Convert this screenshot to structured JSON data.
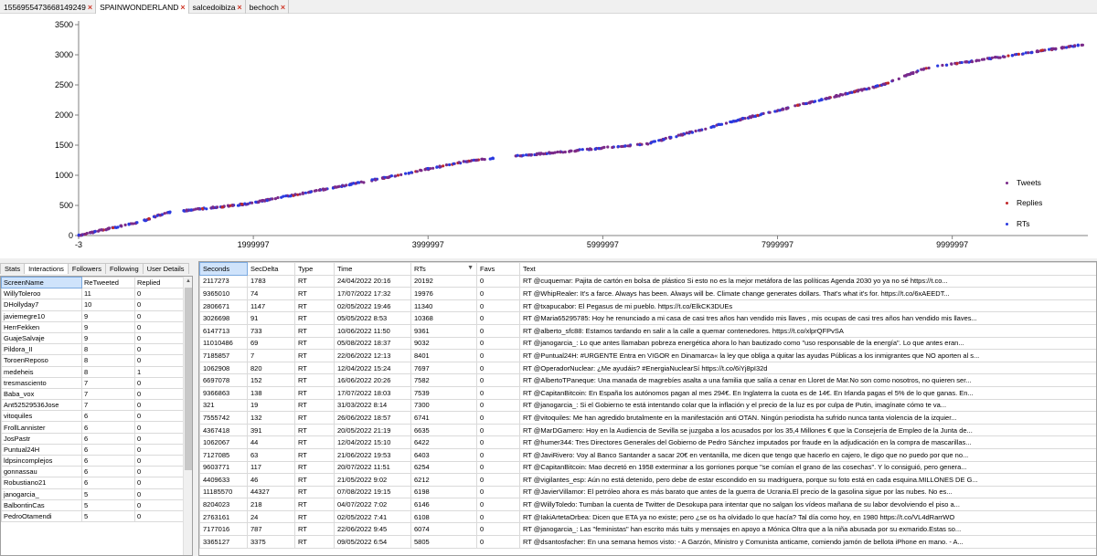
{
  "tabs": [
    {
      "label": "1556955473668149249",
      "active": false
    },
    {
      "label": "SPAINWONDERLAND",
      "active": true
    },
    {
      "label": "salcedoibiza",
      "active": false
    },
    {
      "label": "bechoch",
      "active": false
    }
  ],
  "chart_data": {
    "type": "scatter",
    "title": "",
    "xlabel": "",
    "ylabel": "",
    "xlim": [
      -3,
      11500000
    ],
    "ylim": [
      0,
      3500
    ],
    "x_ticks": [
      "-3",
      "1999997",
      "3999997",
      "5999997",
      "7999997",
      "9999997"
    ],
    "y_ticks": [
      "0",
      "500",
      "1000",
      "1500",
      "2000",
      "2500",
      "3000",
      "3500"
    ],
    "legend_position": "bottom-right",
    "series": [
      {
        "name": "Tweets",
        "color": "#7a2a8a"
      },
      {
        "name": "Replies",
        "color": "#c0282a"
      },
      {
        "name": "RTs",
        "color": "#2a3ae0"
      }
    ],
    "trend_x": [
      0,
      300000,
      700000,
      1000000,
      1900000,
      3300000,
      4500000,
      6500000,
      7500000,
      9200000,
      9700000,
      11000000,
      11500000
    ],
    "trend_y": [
      0,
      100,
      220,
      380,
      520,
      900,
      1250,
      1520,
      1900,
      2500,
      2780,
      3060,
      3170
    ],
    "gaps": [
      [
        1080000,
        1200000
      ],
      [
        4750000,
        4950000
      ],
      [
        8120000,
        8200000
      ]
    ]
  },
  "left_panel": {
    "subtabs": [
      "Stats",
      "Interactions",
      "Followers",
      "Following",
      "User Details"
    ],
    "active_subtab": "Interactions",
    "columns": [
      "ScreenName",
      "ReTweeted",
      "Replied"
    ],
    "rows": [
      [
        "WillyToleroo",
        "11",
        "0"
      ],
      [
        "DHollyday7",
        "10",
        "0"
      ],
      [
        "javiemegre10",
        "9",
        "0"
      ],
      [
        "HerrFekken",
        "9",
        "0"
      ],
      [
        "GuajeSalvaje",
        "9",
        "0"
      ],
      [
        "Pildora_II",
        "8",
        "0"
      ],
      [
        "ToroenReposo",
        "8",
        "0"
      ],
      [
        "medeheis",
        "8",
        "1"
      ],
      [
        "tresmasciento",
        "7",
        "0"
      ],
      [
        "Baba_vox",
        "7",
        "0"
      ],
      [
        "Ant52529536Jose",
        "7",
        "0"
      ],
      [
        "vitoquiles",
        "6",
        "0"
      ],
      [
        "FrollLannister",
        "6",
        "0"
      ],
      [
        "JosPastr",
        "6",
        "0"
      ],
      [
        "Puntual24H",
        "6",
        "0"
      ],
      [
        "ldpsincomplejos",
        "6",
        "0"
      ],
      [
        "gonnassau",
        "6",
        "0"
      ],
      [
        "Robustiano21",
        "6",
        "0"
      ],
      [
        "janogarcia_",
        "5",
        "0"
      ],
      [
        "BalbontinCas",
        "5",
        "0"
      ],
      [
        "PedroOtamendi",
        "5",
        "0"
      ]
    ]
  },
  "right_panel": {
    "columns": [
      "Seconds",
      "SecDelta",
      "Type",
      "Time",
      "RTs",
      "Favs",
      "Text"
    ],
    "rows": [
      [
        "2117273",
        "1783",
        "RT",
        "24/04/2022 20:16",
        "20192",
        "0",
        "RT @cuquemar: Pajita de cartón en bolsa de plástico Si esto no es la mejor metáfora de las políticas Agenda 2030 yo ya no sé https://t.co..."
      ],
      [
        "9365010",
        "74",
        "RT",
        "17/07/2022 17:32",
        "19976",
        "0",
        "RT @WhipRealer: It's a farce. Always has been. Always will be. Climate change generates dollars. That's what it's for. https://t.co/6xAEEDT..."
      ],
      [
        "2806671",
        "1147",
        "RT",
        "02/05/2022 19:46",
        "11340",
        "0",
        "RT @txapucabor: El Pegasus de mi pueblo. https://t.co/ElkCK3DUEs"
      ],
      [
        "3026698",
        "91",
        "RT",
        "05/05/2022 8:53",
        "10368",
        "0",
        "RT @Maria65295785: Hoy he renunciado a mi casa de casi tres años han vendido mis llaves , mis ocupas de casi tres años han vendido mis llaves..."
      ],
      [
        "6147713",
        "733",
        "RT",
        "10/06/2022 11:50",
        "9361",
        "0",
        "RT @alberto_sfc88: Estamos tardando en salir a la calle a quemar contenedores. https://t.co/xlprQFPvSA"
      ],
      [
        "11010486",
        "69",
        "RT",
        "05/08/2022 18:37",
        "9032",
        "0",
        "RT @janogarcia_: Lo que antes llamaban pobreza energética ahora lo han bautizado como \"uso responsable de la energía\". Lo que antes eran..."
      ],
      [
        "7185857",
        "7",
        "RT",
        "22/06/2022 12:13",
        "8401",
        "0",
        "RT @Puntual24H: #URGENTE Entra en VIGOR en Dinamarca« la ley que obliga a quitar las ayudas Públicas a los inmigrantes que NO aporten al s..."
      ],
      [
        "1062908",
        "820",
        "RT",
        "12/04/2022 15:24",
        "7697",
        "0",
        "RT @OperadorNuclear: ¿Me ayudáis? #EnergiaNuclearSí https://t.co/6iYj8pI32d"
      ],
      [
        "6697078",
        "152",
        "RT",
        "16/06/2022 20:26",
        "7582",
        "0",
        "RT @AlbertoTPaneque: Una manada de magrebíes asalta a una familia que salía a cenar en Lloret de Mar.No son como nosotros, no quieren ser..."
      ],
      [
        "9366863",
        "138",
        "RT",
        "17/07/2022 18:03",
        "7539",
        "0",
        "RT @CapitanBitcoin: En España los autónomos pagan al mes 294€. En Inglaterra la cuota es de 14€. En Irlanda pagas el 5% de lo que ganas. En..."
      ],
      [
        "321",
        "19",
        "RT",
        "31/03/2022 8:14",
        "7300",
        "0",
        "RT @janogarcia_: Si el Gobierno te está intentando colar que la inflación y el precio de la luz es por culpa de Putin, imagínate cómo te va..."
      ],
      [
        "7555742",
        "132",
        "RT",
        "26/06/2022 18:57",
        "6741",
        "0",
        "RT @vitoquiles: Me han agredido brutalmente en la manifestación anti OTAN. Ningún periodista ha sufrido nunca tanta violencia de la izquier..."
      ],
      [
        "4367418",
        "391",
        "RT",
        "20/05/2022 21:19",
        "6635",
        "0",
        "RT @MarDGamero: Hoy en la Audiencia de Sevilla se juzgaba a los acusados por los 35,4 Millones € que la Consejería de Empleo de la Junta de..."
      ],
      [
        "1062067",
        "44",
        "RT",
        "12/04/2022 15:10",
        "6422",
        "0",
        "RT @humer344: Tres Directores Generales del Gobierno de Pedro Sánchez imputados por fraude en la adjudicación en la compra de mascarillas..."
      ],
      [
        "7127085",
        "63",
        "RT",
        "21/06/2022 19:53",
        "6403",
        "0",
        "RT @JaviRivero: Voy al Banco Santander a sacar 20€ en ventanilla, me dicen que tengo que hacerlo en cajero, le digo que no puedo por que no..."
      ],
      [
        "9603771",
        "117",
        "RT",
        "20/07/2022 11:51",
        "6254",
        "0",
        "RT @CapitanBitcoin: Mao decretó en 1958 exterminar a los gorriones porque \"se comían el grano de las cosechas\". Y lo consiguió, pero genera..."
      ],
      [
        "4409633",
        "46",
        "RT",
        "21/05/2022 9:02",
        "6212",
        "0",
        "RT @vigilantes_esp: Aún no está detenido, pero debe de estar escondido en su madriguera, porque su foto está en cada esquina.MILLONES DE G..."
      ],
      [
        "11185570",
        "44327",
        "RT",
        "07/08/2022 19:15",
        "6198",
        "0",
        "RT @JavierVillamor: El petróleo ahora es más barato que antes de la guerra de Ucrania.El precio de la gasolina sigue por las nubes. No es..."
      ],
      [
        "8204023",
        "218",
        "RT",
        "04/07/2022 7:02",
        "6146",
        "0",
        "RT @WillyToledo: Tumban la cuenta de Twitter de Desokupa para intentar que no salgan los vídeos mañana de su labor devolviendo el piso a..."
      ],
      [
        "2763161",
        "24",
        "RT",
        "02/05/2022 7:41",
        "6108",
        "0",
        "RT @IakiArtetaOrbea: Dicen que ETA ya no existe; pero ¿se os ha olvidado lo que hacía? Tal día como hoy, en 1980 https://t.co/VL4dRarrWO"
      ],
      [
        "7177016",
        "787",
        "RT",
        "22/06/2022 9:45",
        "6074",
        "0",
        "RT @janogarcia_: Las \"feministas\" han escrito más tuits y mensajes en apoyo a Mónica Oltra que a la niña abusada por su exmarido.Estas so..."
      ],
      [
        "3365127",
        "3375",
        "RT",
        "09/05/2022 6:54",
        "5805",
        "0",
        "RT @dsantosfacher: En una semana hemos visto: - A Garzón, Ministro y Comunista anticame, comiendo jamón de bellota iPhone en mano. - A..."
      ]
    ]
  }
}
